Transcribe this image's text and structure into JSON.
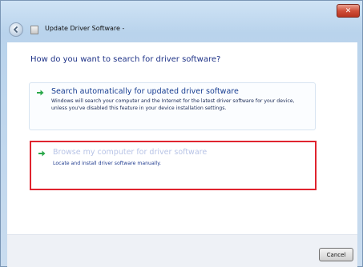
{
  "window": {
    "title": "Update Driver Software -",
    "close_label": "✕"
  },
  "main": {
    "heading": "How do you want to search for driver software?",
    "options": [
      {
        "title": "Search automatically for updated driver software",
        "description": "Windows will search your computer and the Internet for the latest driver software for your device, unless you've disabled this feature in your device installation settings."
      },
      {
        "title": "Browse my computer for driver software",
        "description": "Locate and install driver software manually."
      }
    ]
  },
  "footer": {
    "cancel_label": "Cancel"
  },
  "colors": {
    "highlight_border": "#e0242f",
    "heading": "#1e3287",
    "arrow": "#2aa84a"
  }
}
